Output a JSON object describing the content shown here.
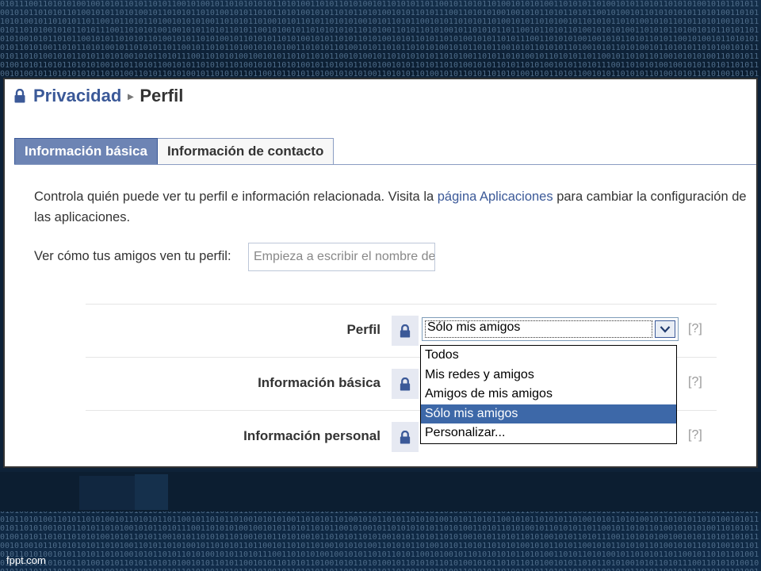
{
  "breadcrumb": {
    "parent": "Privacidad",
    "separator": "▸",
    "current": "Perfil"
  },
  "tabs": [
    {
      "label": "Información básica"
    },
    {
      "label": "Información de contacto"
    }
  ],
  "description": {
    "before": "Controla quién puede ver tu perfil e información relacionada. Visita la ",
    "link": "página Aplicaciones",
    "after": " para cambiar la configuración de las aplicaciones."
  },
  "preview": {
    "label": "Ver cómo tus amigos ven tu perfil:",
    "placeholder": "Empieza a escribir el nombre de un amigo"
  },
  "settings": [
    {
      "label": "Perfil",
      "value": "Sólo mis amigos",
      "help": "[?]"
    },
    {
      "label": "Información básica",
      "help": "[?]"
    },
    {
      "label": "Información personal",
      "help": "[?]"
    }
  ],
  "dropdown": {
    "options": [
      "Todos",
      "Mis redes y amigos",
      "Amigos de mis amigos",
      "Sólo mis amigos",
      "Personalizar..."
    ],
    "selected": "Sólo mis amigos"
  },
  "footer": {
    "brand": "fppt.com"
  },
  "colors": {
    "link": "#3b5998",
    "tab_active": "#6d84b4",
    "highlight": "#3d68a8",
    "background": "#0e2238"
  },
  "background_binary": "0101110011010101001001010110101101011001010010110101010101101010011010110101001011010101101100101101011010010101010011010101101001010110101101010100101011010110010101101010110100101011010100101101010110101001010110101101010010101101011010100101011"
}
